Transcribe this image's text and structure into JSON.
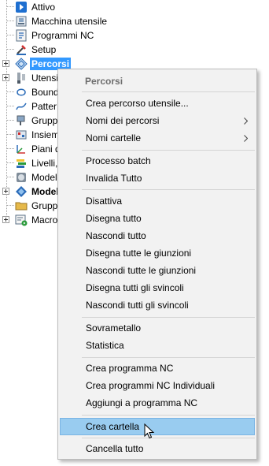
{
  "tree": {
    "nodes": [
      {
        "label": "Attivo",
        "icon": "play-arrow-icon"
      },
      {
        "label": "Macchina utensile",
        "icon": "machine-tool-icon"
      },
      {
        "label": "Programmi NC",
        "icon": "nc-program-icon"
      },
      {
        "label": "Setup",
        "icon": "setup-icon"
      },
      {
        "label": "Percorsi",
        "icon": "toolpaths-icon",
        "selected": true
      },
      {
        "label": "Utensi",
        "icon": "tools-icon"
      },
      {
        "label": "Bound",
        "icon": "boundary-icon"
      },
      {
        "label": "Patter",
        "icon": "pattern-icon"
      },
      {
        "label": "Grupp",
        "icon": "feature-group-icon"
      },
      {
        "label": "Insiem",
        "icon": "feature-set-icon"
      },
      {
        "label": "Piani d",
        "icon": "workplane-icon"
      },
      {
        "label": "Livelli,",
        "icon": "levels-icon"
      },
      {
        "label": "Model",
        "icon": "model-icon"
      },
      {
        "label": "Model",
        "icon": "model-bold-icon",
        "bold": true
      },
      {
        "label": "Grupp",
        "icon": "folder-group-icon"
      },
      {
        "label": "Macro",
        "icon": "macro-icon"
      }
    ]
  },
  "context_menu": {
    "title": "Percorsi",
    "groups": [
      [
        {
          "label": "Crea percorso utensile..."
        },
        {
          "label": "Nomi dei percorsi",
          "submenu": true
        },
        {
          "label": "Nomi cartelle",
          "submenu": true
        }
      ],
      [
        {
          "label": "Processo batch"
        },
        {
          "label": "Invalida Tutto"
        }
      ],
      [
        {
          "label": "Disattiva"
        },
        {
          "label": "Disegna tutto"
        },
        {
          "label": "Nascondi tutto"
        },
        {
          "label": "Disegna tutte le giunzioni"
        },
        {
          "label": "Nascondi tutte le giunzioni"
        },
        {
          "label": "Disegna tutti gli svincoli"
        },
        {
          "label": "Nascondi tutti gli svincoli"
        }
      ],
      [
        {
          "label": "Sovrametallo"
        },
        {
          "label": "Statistica"
        }
      ],
      [
        {
          "label": "Crea programma NC"
        },
        {
          "label": "Crea programmi NC Individuali"
        },
        {
          "label": "Aggiungi a programma NC"
        }
      ],
      [
        {
          "label": "Crea cartella",
          "highlighted": true
        }
      ],
      [
        {
          "label": "Cancella tutto"
        }
      ]
    ]
  },
  "colors": {
    "selection": "#3399ff",
    "menu_background": "#f2f2f2",
    "menu_highlight": "#99ccf0",
    "menu_title": "#6d6d6d"
  }
}
